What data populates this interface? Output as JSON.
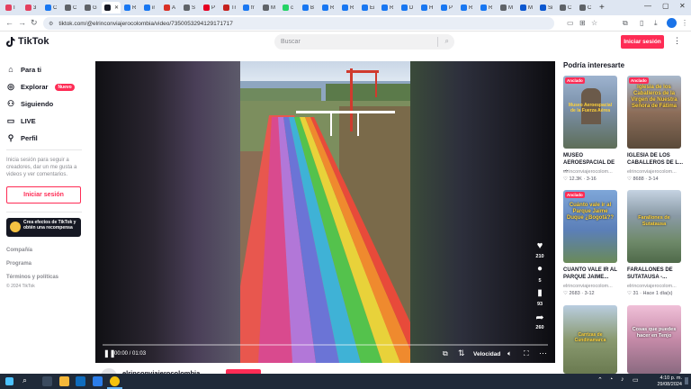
{
  "browser": {
    "tabs": [
      {
        "label": "I",
        "color": "#e4405f"
      },
      {
        "label": "3",
        "color": "#e4405f"
      },
      {
        "label": "C",
        "color": "#1877f2"
      },
      {
        "label": "C",
        "color": "#5f6368"
      },
      {
        "label": "G",
        "color": "#5f6368"
      },
      {
        "label": "",
        "color": "#161823",
        "active": true
      },
      {
        "label": "R",
        "color": "#1877f2"
      },
      {
        "label": "ir",
        "color": "#1877f2"
      },
      {
        "label": "A",
        "color": "#d93025"
      },
      {
        "label": "S",
        "color": "#5f6368"
      },
      {
        "label": "P",
        "color": "#e60023"
      },
      {
        "label": "Tr",
        "color": "#c5221f"
      },
      {
        "label": "fr",
        "color": "#1877f2"
      },
      {
        "label": "M",
        "color": "#5f6368"
      },
      {
        "label": "c",
        "color": "#25d366"
      },
      {
        "label": "B",
        "color": "#1877f2"
      },
      {
        "label": "R",
        "color": "#1877f2"
      },
      {
        "label": "R",
        "color": "#1877f2"
      },
      {
        "label": "Ei",
        "color": "#1877f2"
      },
      {
        "label": "R",
        "color": "#1877f2"
      },
      {
        "label": "D",
        "color": "#1877f2"
      },
      {
        "label": "H",
        "color": "#1877f2"
      },
      {
        "label": "P",
        "color": "#1877f2"
      },
      {
        "label": "R",
        "color": "#1877f2"
      },
      {
        "label": "R",
        "color": "#1877f2"
      },
      {
        "label": "M",
        "color": "#5f6368"
      },
      {
        "label": "M",
        "color": "#0b57d0"
      },
      {
        "label": "Si",
        "color": "#0b57d0"
      },
      {
        "label": "C",
        "color": "#5f6368"
      },
      {
        "label": "C",
        "color": "#5f6368"
      }
    ],
    "new_tab": "+",
    "url": "tiktok.com/@elrinconviajerocolombia/video/7350053294129171717"
  },
  "header": {
    "logo_text": "TikTok",
    "search_placeholder": "Buscar",
    "login_label": "Iniciar sesión"
  },
  "sidebar": {
    "items": [
      {
        "label": "Para ti"
      },
      {
        "label": "Explorar",
        "badge": "Nuevo"
      },
      {
        "label": "Siguiendo"
      },
      {
        "label": "LIVE"
      },
      {
        "label": "Perfil"
      }
    ],
    "prompt": "Inicia sesión para seguir a creadores, dar un me gusta a videos y ver comentarios.",
    "login_label": "Iniciar sesión",
    "effects_card": "Crea efectos de TikTok y obtén una recompensa",
    "links": [
      "Compañía",
      "Programa",
      "Términos y políticas"
    ],
    "copyright": "© 2024 TikTok"
  },
  "video": {
    "time": "00:00 / 01:03",
    "progress": 0.0,
    "speed_label": "Velocidad",
    "likes": "210",
    "comments": "5",
    "saves": "93",
    "shares": "260",
    "author": "elrinconviajerocolombia"
  },
  "suggestions": {
    "title": "Podría interesarte",
    "cards": [
      {
        "pinned": "Anclado",
        "thumb_text": "Museo Aeroespacial de la Fuerza Aérea",
        "title": "MUSEO AEROESPACIAL DE ...",
        "author": "elrinconviajerocolom...",
        "views": "12.3K",
        "age": "3-16",
        "thumb_color": "#7a8fa8"
      },
      {
        "pinned": "Anclado",
        "thumb_text": "Iglesia de los Caballeros de la Virgen de Nuestra Señora de Fátima",
        "title": "IGLESIA DE LOS CABALLEROS DE L...",
        "author": "elrinconviajerocolom...",
        "views": "8688",
        "age": "3-14",
        "thumb_color": "#8d6e5a"
      },
      {
        "pinned": "Anclado",
        "thumb_text": "Cuánto vale ir al Parque Jaime Duque ¿Bogotá??",
        "title": "CUANTO VALE IR AL PARQUE JAIME...",
        "author": "elrinconviajerocolom...",
        "views": "2683",
        "age": "3-12",
        "thumb_color": "#5b7fb8"
      },
      {
        "pinned": "",
        "thumb_text": "Farallones de Sutatausa",
        "title": "FARALLONES DE SUTATAUSA -...",
        "author": "elrinconviajerocolom...",
        "views": "31",
        "age": "Hace 1 día(s)",
        "thumb_color": "#6f8a6a"
      },
      {
        "pinned": "",
        "thumb_text": "Carrizas de Cundinamarca",
        "title": "",
        "author": "",
        "views": "",
        "age": "",
        "thumb_color": "#8a9a70"
      },
      {
        "pinned": "",
        "thumb_text": "Cosas que puedes hacer en Tenjo",
        "title": "",
        "author": "",
        "views": "",
        "age": "",
        "thumb_color": "#c58aa8"
      }
    ]
  },
  "taskbar": {
    "time": "4:10 p. m.",
    "date": "29/08/2024"
  }
}
